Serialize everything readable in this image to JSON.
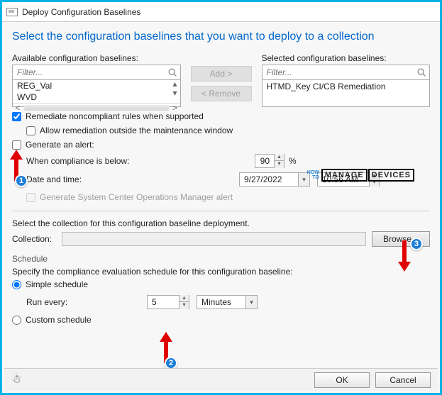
{
  "window": {
    "title": "Deploy Configuration Baselines",
    "heading": "Select the configuration baselines that you want to deploy to a collection"
  },
  "available": {
    "label": "Available configuration baselines:",
    "filter_placeholder": "Filter...",
    "items": [
      "REG_Val",
      "WVD"
    ]
  },
  "selected": {
    "label": "Selected configuration baselines:",
    "filter_placeholder": "Filter...",
    "items": [
      "HTMD_Key CI/CB Remediation"
    ]
  },
  "midbuttons": {
    "add": "Add >",
    "remove": "< Remove"
  },
  "options": {
    "remediate": "Remediate noncompliant rules when supported",
    "allow_outside": "Allow remediation outside the maintenance window",
    "generate_alert": "Generate an alert:",
    "compliance_label": "When compliance is below:",
    "compliance_value": "90",
    "compliance_pct": "%",
    "datetime_label": "Date and time:",
    "date_value": "9/27/2022",
    "time_value": "10:56 AM",
    "scom": "Generate System Center Operations Manager alert"
  },
  "collection": {
    "title": "Select the collection for this configuration baseline deployment.",
    "label": "Collection:",
    "value": "",
    "browse": "Browse..."
  },
  "schedule": {
    "group": "Schedule",
    "title": "Specify the compliance evaluation schedule for this configuration baseline:",
    "simple": "Simple schedule",
    "run_every": "Run every:",
    "value": "5",
    "unit": "Minutes",
    "custom": "Custom schedule"
  },
  "footer": {
    "ok": "OK",
    "cancel": "Cancel"
  },
  "annotations": {
    "a1": "1",
    "a2": "2",
    "a3": "3"
  },
  "logo": {
    "l1": "HOW",
    "l2": "TO",
    "l3": "MANAGE",
    "l4": "DEVICES"
  }
}
